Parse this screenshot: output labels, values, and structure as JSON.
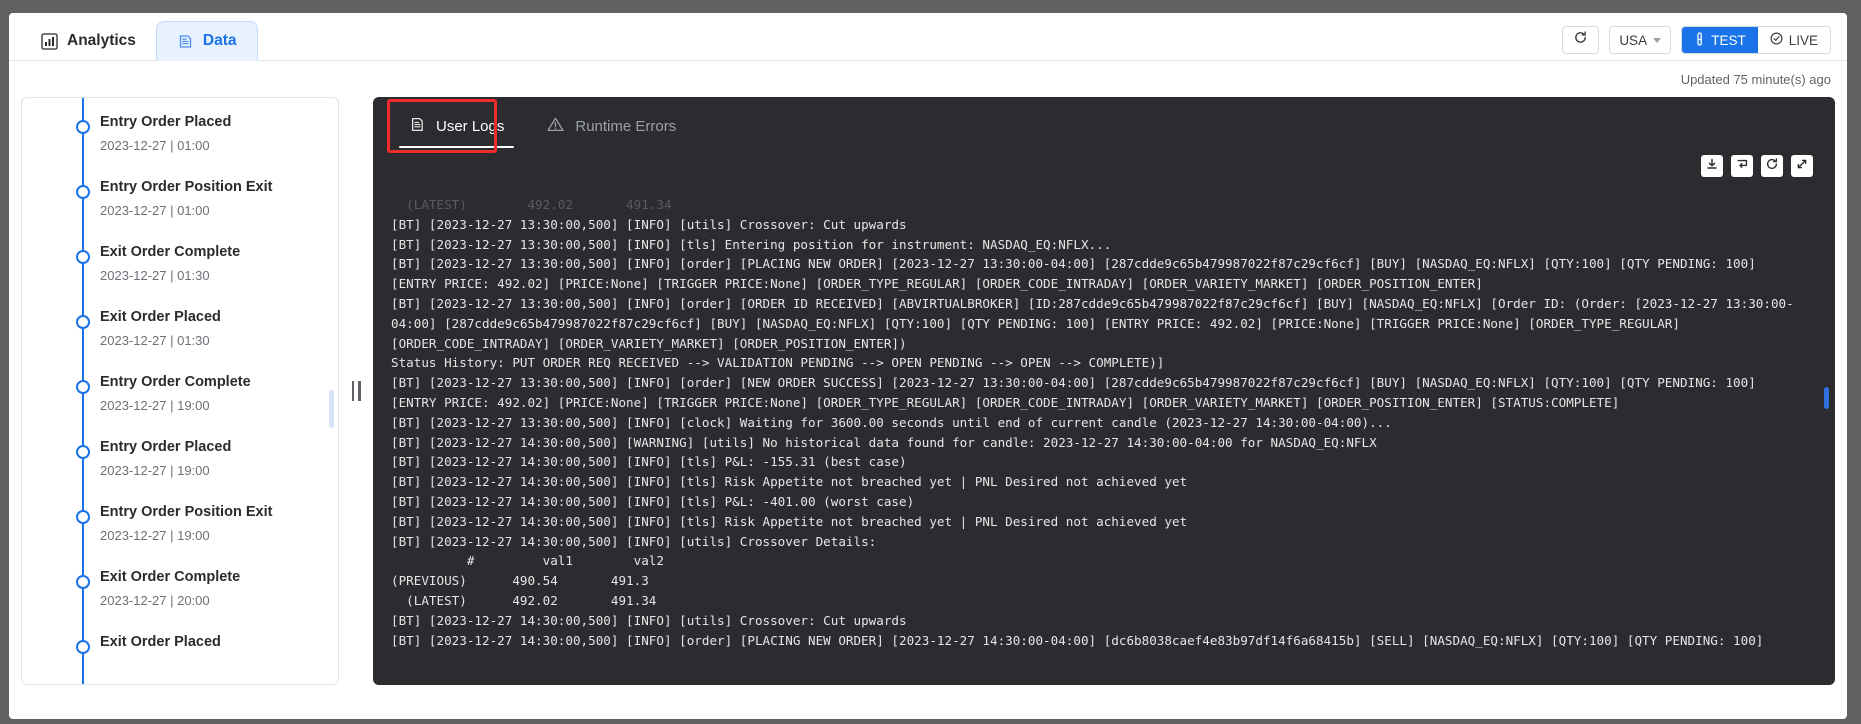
{
  "window": {
    "background_color": "#616161",
    "ghost_cards": [
      "card-left",
      "card-right"
    ]
  },
  "tabbar": {
    "tabs": [
      {
        "label": "Analytics",
        "icon": "bar-chart-icon",
        "active": false
      },
      {
        "label": "Data",
        "icon": "database-icon",
        "active": true
      }
    ]
  },
  "topright": {
    "refresh_icon": "refresh-icon",
    "region": {
      "label": "USA",
      "caret_icon": "chevron-down-icon"
    },
    "mode": [
      {
        "label": "TEST",
        "icon": "test-tube-icon",
        "active": true
      },
      {
        "label": "LIVE",
        "icon": "check-circle-icon",
        "active": false
      }
    ]
  },
  "status": {
    "updated_text": "Updated 75 minute(s) ago"
  },
  "timeline": {
    "scroll_thumb": "timeline-scrollbar",
    "events": [
      {
        "title": "Entry Order Placed",
        "time": "2023-12-27 | 01:00"
      },
      {
        "title": "Entry Order Position Exit",
        "time": "2023-12-27 | 01:00"
      },
      {
        "title": "Exit Order Complete",
        "time": "2023-12-27 | 01:30"
      },
      {
        "title": "Exit Order Placed",
        "time": "2023-12-27 | 01:30"
      },
      {
        "title": "Entry Order Complete",
        "time": "2023-12-27 | 19:00"
      },
      {
        "title": "Entry Order Placed",
        "time": "2023-12-27 | 19:00"
      },
      {
        "title": "Entry Order Position Exit",
        "time": "2023-12-27 | 19:00"
      },
      {
        "title": "Exit Order Complete",
        "time": "2023-12-27 | 20:00"
      },
      {
        "title": "Exit Order Placed",
        "time": ""
      }
    ]
  },
  "log_panel": {
    "tabs": [
      {
        "label": "User Logs",
        "icon": "document-log-icon",
        "active": true
      },
      {
        "label": "Runtime Errors",
        "icon": "warning-triangle-icon",
        "active": false
      }
    ],
    "toolbar": [
      {
        "name": "download-icon"
      },
      {
        "name": "wrap-text-icon"
      },
      {
        "name": "refresh-icon"
      },
      {
        "name": "expand-icon"
      }
    ],
    "accent_color": "#2f6fe0",
    "background_color": "#2b2b30",
    "lines": [
      {
        "text": "  (LATEST)        492.02       491.34",
        "faded": true
      },
      {
        "text": "[BT] [2023-12-27 13:30:00,500] [INFO] [utils] Crossover: Cut upwards",
        "faded": false
      },
      {
        "text": "[BT] [2023-12-27 13:30:00,500] [INFO] [tls] Entering position for instrument: NASDAQ_EQ:NFLX...",
        "faded": false
      },
      {
        "text": "[BT] [2023-12-27 13:30:00,500] [INFO] [order] [PLACING NEW ORDER] [2023-12-27 13:30:00-04:00] [287cdde9c65b479987022f87c29cf6cf] [BUY] [NASDAQ_EQ:NFLX] [QTY:100] [QTY PENDING: 100]",
        "faded": false
      },
      {
        "text": "[ENTRY PRICE: 492.02] [PRICE:None] [TRIGGER PRICE:None] [ORDER_TYPE_REGULAR] [ORDER_CODE_INTRADAY] [ORDER_VARIETY_MARKET] [ORDER_POSITION_ENTER]",
        "faded": false
      },
      {
        "text": "[BT] [2023-12-27 13:30:00,500] [INFO] [order] [ORDER ID RECEIVED] [ABVIRTUALBROKER] [ID:287cdde9c65b479987022f87c29cf6cf] [BUY] [NASDAQ_EQ:NFLX] [Order ID: (Order: [2023-12-27 13:30:00-",
        "faded": false
      },
      {
        "text": "04:00] [287cdde9c65b479987022f87c29cf6cf] [BUY] [NASDAQ_EQ:NFLX] [QTY:100] [QTY PENDING: 100] [ENTRY PRICE: 492.02] [PRICE:None] [TRIGGER PRICE:None] [ORDER_TYPE_REGULAR]",
        "faded": false
      },
      {
        "text": "[ORDER_CODE_INTRADAY] [ORDER_VARIETY_MARKET] [ORDER_POSITION_ENTER])",
        "faded": false
      },
      {
        "text": "Status History: PUT ORDER REQ RECEIVED --> VALIDATION PENDING --> OPEN PENDING --> OPEN --> COMPLETE)]",
        "faded": false
      },
      {
        "text": "[BT] [2023-12-27 13:30:00,500] [INFO] [order] [NEW ORDER SUCCESS] [2023-12-27 13:30:00-04:00] [287cdde9c65b479987022f87c29cf6cf] [BUY] [NASDAQ_EQ:NFLX] [QTY:100] [QTY PENDING: 100]",
        "faded": false
      },
      {
        "text": "[ENTRY PRICE: 492.02] [PRICE:None] [TRIGGER PRICE:None] [ORDER_TYPE_REGULAR] [ORDER_CODE_INTRADAY] [ORDER_VARIETY_MARKET] [ORDER_POSITION_ENTER] [STATUS:COMPLETE]",
        "faded": false
      },
      {
        "text": "[BT] [2023-12-27 13:30:00,500] [INFO] [clock] Waiting for 3600.00 seconds until end of current candle (2023-12-27 14:30:00-04:00)...",
        "faded": false
      },
      {
        "text": "[BT] [2023-12-27 14:30:00,500] [WARNING] [utils] No historical data found for candle: 2023-12-27 14:30:00-04:00 for NASDAQ_EQ:NFLX",
        "faded": false
      },
      {
        "text": "[BT] [2023-12-27 14:30:00,500] [INFO] [tls] P&L: -155.31 (best case)",
        "faded": false
      },
      {
        "text": "[BT] [2023-12-27 14:30:00,500] [INFO] [tls] Risk Appetite not breached yet | PNL Desired not achieved yet",
        "faded": false
      },
      {
        "text": "[BT] [2023-12-27 14:30:00,500] [INFO] [tls] P&L: -401.00 (worst case)",
        "faded": false
      },
      {
        "text": "[BT] [2023-12-27 14:30:00,500] [INFO] [tls] Risk Appetite not breached yet | PNL Desired not achieved yet",
        "faded": false
      },
      {
        "text": "[BT] [2023-12-27 14:30:00,500] [INFO] [utils] Crossover Details:",
        "faded": false
      },
      {
        "text": "          #         val1        val2",
        "faded": false
      },
      {
        "text": "(PREVIOUS)      490.54       491.3",
        "faded": false
      },
      {
        "text": "  (LATEST)      492.02       491.34",
        "faded": false
      },
      {
        "text": "[BT] [2023-12-27 14:30:00,500] [INFO] [utils] Crossover: Cut upwards",
        "faded": false
      },
      {
        "text": "[BT] [2023-12-27 14:30:00,500] [INFO] [order] [PLACING NEW ORDER] [2023-12-27 14:30:00-04:00] [dc6b8038caef4e83b97df14f6a68415b] [SELL] [NASDAQ_EQ:NFLX] [QTY:100] [QTY PENDING: 100]",
        "faded": false
      }
    ]
  }
}
